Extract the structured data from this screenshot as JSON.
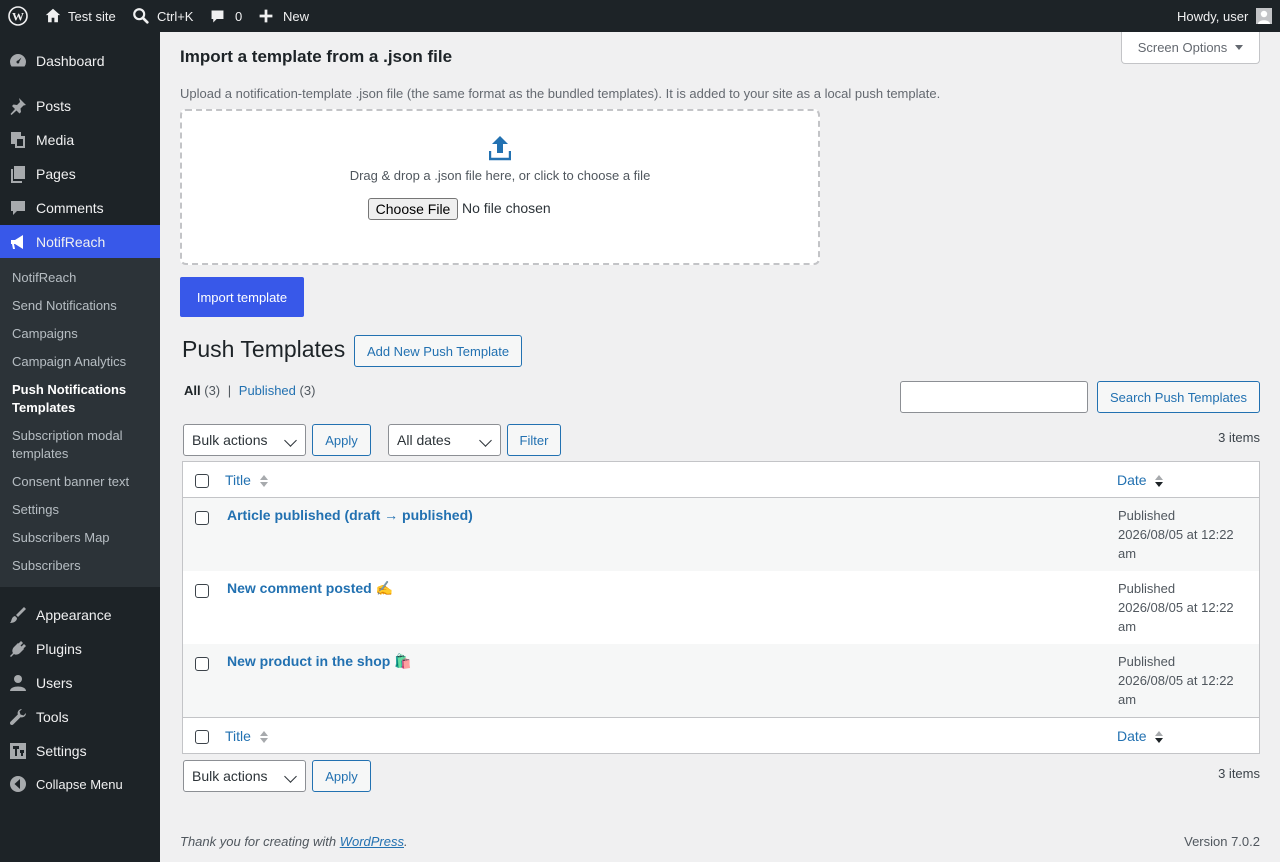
{
  "adminbar": {
    "site_name": "Test site",
    "search_shortcut": "Ctrl+K",
    "comments_count": "0",
    "new_label": "New",
    "howdy": "Howdy, user"
  },
  "sidebar": {
    "menu": [
      {
        "label": "Dashboard",
        "icon": "dashboard-icon"
      },
      {
        "label": "Posts",
        "icon": "pushpin-icon"
      },
      {
        "label": "Media",
        "icon": "media-icon"
      },
      {
        "label": "Pages",
        "icon": "pages-icon"
      },
      {
        "label": "Comments",
        "icon": "comment-icon"
      },
      {
        "label": "NotifReach",
        "icon": "megaphone-icon"
      },
      {
        "label": "Appearance",
        "icon": "paintbrush-icon"
      },
      {
        "label": "Plugins",
        "icon": "plug-icon"
      },
      {
        "label": "Users",
        "icon": "user-icon"
      },
      {
        "label": "Tools",
        "icon": "wrench-icon"
      },
      {
        "label": "Settings",
        "icon": "settings-icon"
      },
      {
        "label": "Collapse Menu",
        "icon": "collapse-icon"
      }
    ],
    "submenu": [
      "NotifReach",
      "Send Notifications",
      "Campaigns",
      "Campaign Analytics",
      "Push Notifications Templates",
      "Subscription modal templates",
      "Consent banner text",
      "Settings",
      "Subscribers Map",
      "Subscribers"
    ]
  },
  "screen_options": "Screen Options",
  "import": {
    "heading": "Import a template from a .json file",
    "description": "Upload a notification-template .json file (the same format as the bundled templates). It is added to your site as a local push template.",
    "drop_text": "Drag & drop a .json file here, or click to choose a file",
    "choose_file": "Choose File",
    "no_file": "No file chosen",
    "import_button": "Import template"
  },
  "list": {
    "title": "Push Templates",
    "add_new": "Add New Push Template",
    "filters": {
      "all_label": "All",
      "all_count": "(3)",
      "separator": "|",
      "published_label": "Published",
      "published_count": "(3)"
    },
    "search_value": "",
    "search_button": "Search Push Templates",
    "bulk_actions": "Bulk actions",
    "apply": "Apply",
    "all_dates": "All dates",
    "filter": "Filter",
    "items_count": "3 items",
    "columns": {
      "title": "Title",
      "date": "Date"
    },
    "rows": [
      {
        "title": "Article published (draft → published)",
        "status": "Published",
        "date": "2026/08/05 at 12:22",
        "time_suffix": "am"
      },
      {
        "title": "New comment posted ✍️",
        "status": "Published",
        "date": "2026/08/05 at 12:22",
        "time_suffix": "am"
      },
      {
        "title": "New product in the shop 🛍️",
        "status": "Published",
        "date": "2026/08/05 at 12:22",
        "time_suffix": "am"
      }
    ]
  },
  "footer": {
    "thanks_prefix": "Thank you for creating with ",
    "wordpress_link": "WordPress",
    "thanks_suffix": ".",
    "version": "Version 7.0.2"
  },
  "colors": {
    "accent": "#3858e9",
    "link": "#2271b1",
    "adminbar_bg": "#1d2327",
    "submenu_bg": "#2c3338"
  }
}
